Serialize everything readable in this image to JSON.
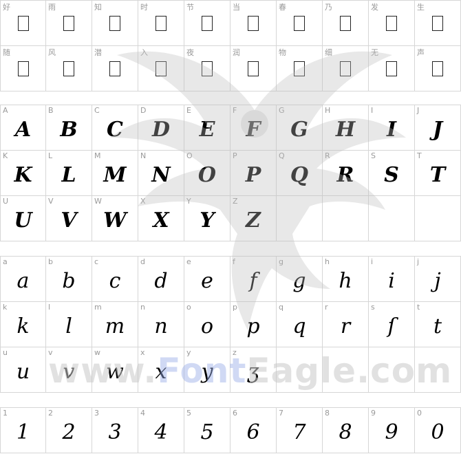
{
  "cjk_rows": [
    [
      "好",
      "雨",
      "知",
      "时",
      "节",
      "当",
      "春",
      "乃",
      "发",
      "生"
    ],
    [
      "随",
      "风",
      "潜",
      "入",
      "夜",
      "润",
      "物",
      "细",
      "无",
      "声"
    ]
  ],
  "upper_rows": [
    [
      "A",
      "B",
      "C",
      "D",
      "E",
      "F",
      "G",
      "H",
      "I",
      "J"
    ],
    [
      "K",
      "L",
      "M",
      "N",
      "O",
      "P",
      "Q",
      "R",
      "S",
      "T"
    ],
    [
      "U",
      "V",
      "W",
      "X",
      "Y",
      "Z"
    ]
  ],
  "lower_rows": [
    [
      "a",
      "b",
      "c",
      "d",
      "e",
      "f",
      "g",
      "h",
      "i",
      "j"
    ],
    [
      "k",
      "l",
      "m",
      "n",
      "o",
      "p",
      "q",
      "r",
      "s",
      "t"
    ],
    [
      "u",
      "v",
      "w",
      "x",
      "y",
      "z"
    ]
  ],
  "digit_rows": [
    [
      "1",
      "2",
      "3",
      "4",
      "5",
      "6",
      "7",
      "8",
      "9",
      "0"
    ]
  ],
  "lower_display_overrides": {
    "s": "ſ",
    "z": "ʒ"
  },
  "watermark": {
    "part1": "www.",
    "part2": "Font",
    "part3": "Eagle.com"
  }
}
